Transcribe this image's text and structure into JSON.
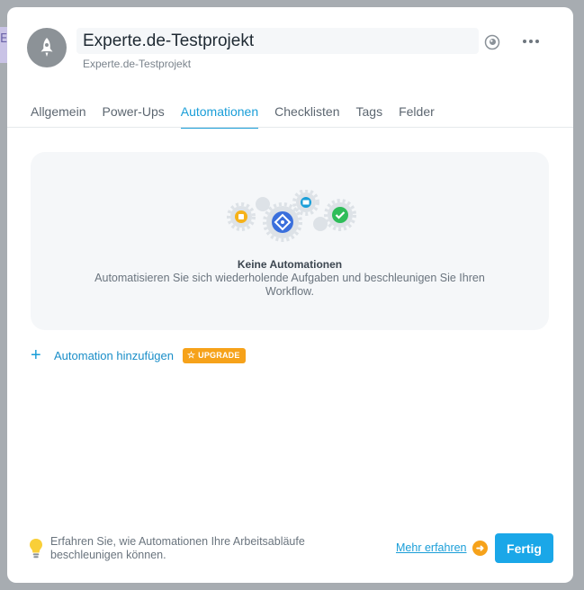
{
  "background": {
    "partial_letter": "E"
  },
  "project": {
    "title": "Experte.de-Testprojekt",
    "subtitle": "Experte.de-Testprojekt",
    "avatar_icon": "rocket-icon"
  },
  "header_actions": {
    "visibility_icon": "eye-icon",
    "menu_icon": "more-horizontal-icon"
  },
  "tabs": [
    {
      "label": "Allgemein",
      "active": false
    },
    {
      "label": "Power-Ups",
      "active": false
    },
    {
      "label": "Automationen",
      "active": true
    },
    {
      "label": "Checklisten",
      "active": false
    },
    {
      "label": "Tags",
      "active": false
    },
    {
      "label": "Felder",
      "active": false
    }
  ],
  "empty_state": {
    "title": "Keine Automationen",
    "description": "Automatisieren Sie sich wiederholende Aufgaben und beschleunigen Sie Ihren Workflow."
  },
  "add_automation": {
    "label": "Automation hinzufügen",
    "badge": "UPGRADE"
  },
  "footer": {
    "info_text": "Erfahren Sie, wie Automationen Ihre Arbeitsabläufe beschleunigen können.",
    "more_link": "Mehr erfahren",
    "done_button": "Fertig"
  },
  "colors": {
    "accent": "#1a9ed8",
    "badge": "#f6a21a",
    "button": "#1aa7e8"
  }
}
